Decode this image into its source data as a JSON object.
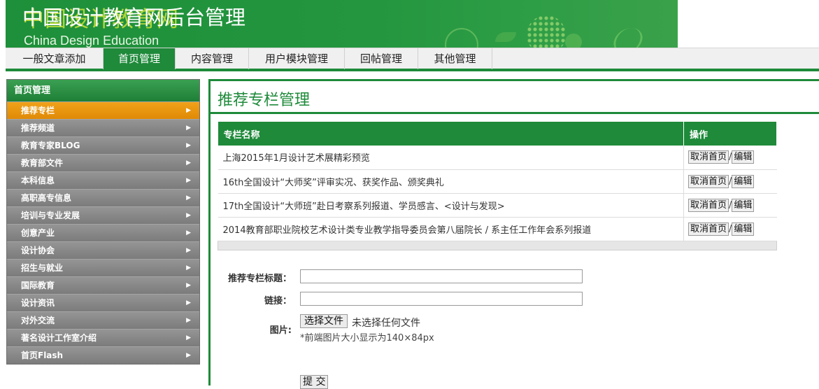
{
  "header": {
    "title": "中国设计教育网后台管理",
    "title_ghost": "中国设计教育网",
    "subtitle": "China Design Education"
  },
  "nav": {
    "items": [
      {
        "label": "一般文章添加",
        "active": false
      },
      {
        "label": "首页管理",
        "active": true
      },
      {
        "label": "内容管理",
        "active": false
      },
      {
        "label": "用户模块管理",
        "active": false
      },
      {
        "label": "回帖管理",
        "active": false
      },
      {
        "label": "其他管理",
        "active": false
      }
    ]
  },
  "sidebar": {
    "title": "首页管理",
    "items": [
      {
        "label": "推荐专栏",
        "active": true
      },
      {
        "label": "推荐频道",
        "active": false
      },
      {
        "label": "教育专家BLOG",
        "active": false
      },
      {
        "label": "教育部文件",
        "active": false
      },
      {
        "label": "本科信息",
        "active": false
      },
      {
        "label": "高职高专信息",
        "active": false
      },
      {
        "label": "培训与专业发展",
        "active": false
      },
      {
        "label": "创意产业",
        "active": false
      },
      {
        "label": "设计协会",
        "active": false
      },
      {
        "label": "招生与就业",
        "active": false
      },
      {
        "label": "国际教育",
        "active": false
      },
      {
        "label": "设计资讯",
        "active": false
      },
      {
        "label": "对外交流",
        "active": false
      },
      {
        "label": "著名设计工作室介绍",
        "active": false
      },
      {
        "label": "首页Flash",
        "active": false
      }
    ],
    "arrow": "▶"
  },
  "main": {
    "title": "推荐专栏管理",
    "table": {
      "headers": [
        "专栏名称",
        "操作"
      ],
      "rows": [
        "上海2015年1月设计艺术展精彩预览",
        "16th全国设计“大师奖”评审实况、获奖作品、颁奖典礼",
        "17th全国设计“大师班”赴日考察系列报道、学员感言、<设计与发现>",
        "2014教育部职业院校艺术设计类专业教学指导委员会第八届院长 / 系主任工作年会系列报道"
      ],
      "op_cancel": "取消首页",
      "op_sep": "/",
      "op_edit": "编辑"
    },
    "form": {
      "title_label": "推荐专栏标题：",
      "title_value": "",
      "link_label": "链接：",
      "link_value": "",
      "image_label": "图片:",
      "file_button": "选择文件",
      "file_status": "未选择任何文件",
      "hint": "*前端图片大小显示为140×84px",
      "submit": "提 交"
    }
  },
  "colors": {
    "brand_green": "#1e8a3a",
    "active_orange": "#e8930c",
    "sidebar_gray": "#8a8a8a"
  }
}
